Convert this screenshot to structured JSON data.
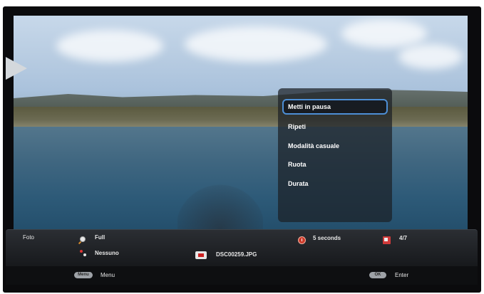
{
  "context_menu": {
    "items": [
      {
        "label": "Metti in pausa",
        "selected": true
      },
      {
        "label": "Ripeti",
        "selected": false
      },
      {
        "label": "Modalità casuale",
        "selected": false
      },
      {
        "label": "Ruota",
        "selected": false
      },
      {
        "label": "Durata",
        "selected": false
      }
    ]
  },
  "info_bar": {
    "category": "Foto",
    "zoom_mode": "Full",
    "music": "Nessuno",
    "file_name": "DSC00259.JPG",
    "interval": "5 seconds",
    "counter": "4/7"
  },
  "footer": {
    "menu_label": "Menu",
    "enter_label": "Enter",
    "menu_key": "Menu",
    "ok_key": "OK"
  },
  "icons": {
    "left": "left-arrow-icon",
    "zoom": "search-icon",
    "music": "music-icon",
    "file": "photo-icon",
    "interval": "clock-icon",
    "counter": "slideshow-counter-icon"
  },
  "colors": {
    "menu_highlight": "#4d8fd6",
    "accent_red": "#cc3b2b"
  }
}
